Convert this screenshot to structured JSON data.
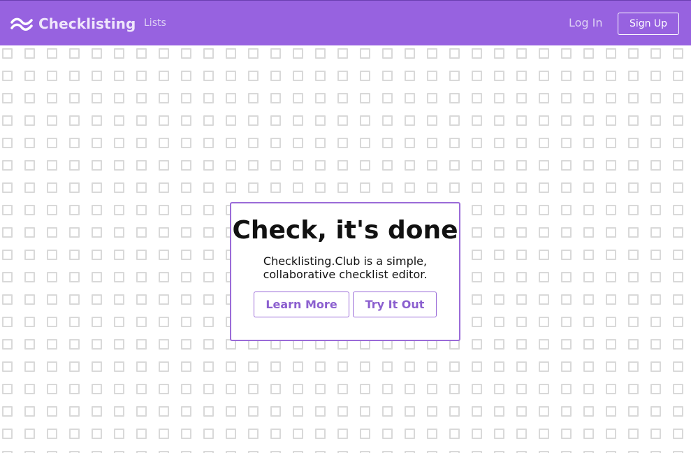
{
  "colors": {
    "nav_background": "#9762e0",
    "accent": "#9a6bd8",
    "pattern_square": "#d9d9d9"
  },
  "header": {
    "logo_icon": "wave-icon",
    "brand": "Checklisting",
    "nav_link": "Lists",
    "login": "Log In",
    "signup": "Sign Up"
  },
  "background": {
    "icon": "checkbox-outline-icon"
  },
  "hero": {
    "title": "Check, it's done",
    "description_line1": "Checklisting.Club is a simple,",
    "description_line2": "collaborative checklist editor.",
    "learn_more": "Learn More",
    "try_it_out": "Try It Out"
  }
}
